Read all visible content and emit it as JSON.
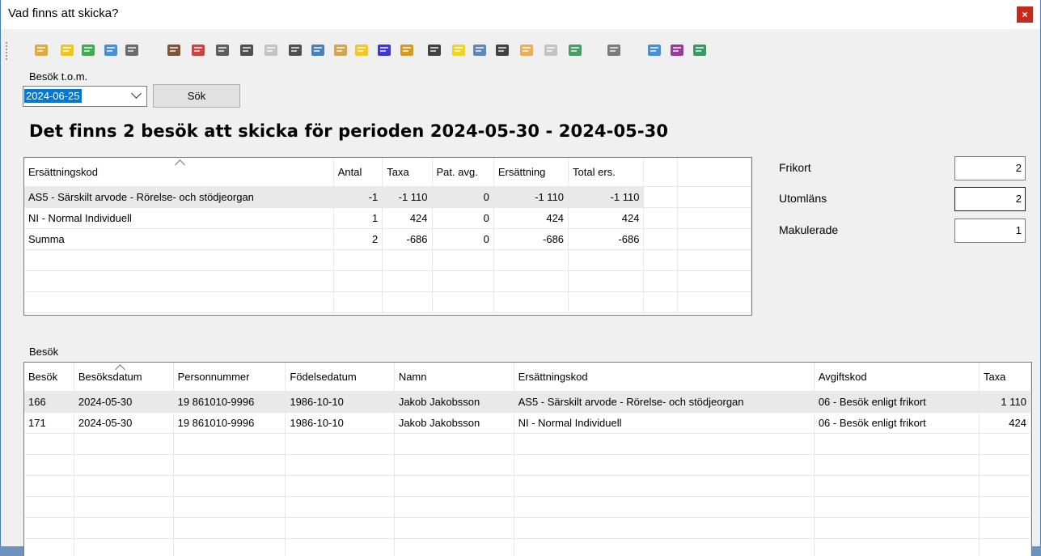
{
  "window": {
    "title": "Vad finns att skicka?",
    "close_label": "×"
  },
  "toolbar": {
    "icons": [
      "open-folder-icon",
      "help-icon",
      "check-icon",
      "refresh-icon",
      "journal-icon",
      "bag-icon",
      "edit-icon",
      "scan-bestk-icon",
      "besok-icon",
      "besok-disabled-icon",
      "document-p-icon",
      "notes-icon",
      "calculator-icon",
      "calculator-yellow-icon",
      "m-icon",
      "invoice-icon",
      "phone-icon",
      "id-icon",
      "form-icon",
      "b-icon",
      "colorgrid-icon",
      "f-disabled-icon",
      "syringe-icon",
      "settings-icon",
      "card-icon",
      "book-icon",
      "door-icon"
    ]
  },
  "filter": {
    "label": "Besök t.o.m.",
    "date_value": "2024-06-25",
    "search_button": "Sök"
  },
  "heading": "Det finns 2 besök att skicka för perioden 2024-05-30 - 2024-05-30",
  "summary_table": {
    "columns": [
      "Ersättningskod",
      "Antal",
      "Taxa",
      "Pat. avg.",
      "Ersättning",
      "Total ers."
    ],
    "rows": [
      [
        "AS5 - Särskilt arvode - Rörelse- och stödjeorgan",
        "-1",
        "-1 110",
        "0",
        "-1 110",
        "-1 110"
      ],
      [
        "NI - Normal Individuell",
        "1",
        "424",
        "0",
        "424",
        "424"
      ],
      [
        "Summa",
        "2",
        "-686",
        "0",
        "-686",
        "-686"
      ]
    ]
  },
  "counters": {
    "frikort_label": "Frikort",
    "frikort_value": "2",
    "utomlans_label": "Utomläns",
    "utomlans_value": "2",
    "makulerade_label": "Makulerade",
    "makulerade_value": "1"
  },
  "visits": {
    "label": "Besök",
    "columns": [
      "Besök",
      "Besöksdatum",
      "Personnummer",
      "Födelsedatum",
      "Namn",
      "Ersättningskod",
      "Avgiftskod",
      "Taxa"
    ],
    "rows": [
      [
        "166",
        "2024-05-30",
        "19 861010-9996",
        "1986-10-10",
        "Jakob Jakobsson",
        "AS5 - Särskilt arvode - Rörelse- och stödjeorgan",
        "06 - Besök enligt frikort",
        "1 110"
      ],
      [
        "171",
        "2024-05-30",
        "19 861010-9996",
        "1986-10-10",
        "Jakob Jakobsson",
        "NI - Normal Individuell",
        "06 - Besök enligt frikort",
        "424"
      ]
    ]
  }
}
